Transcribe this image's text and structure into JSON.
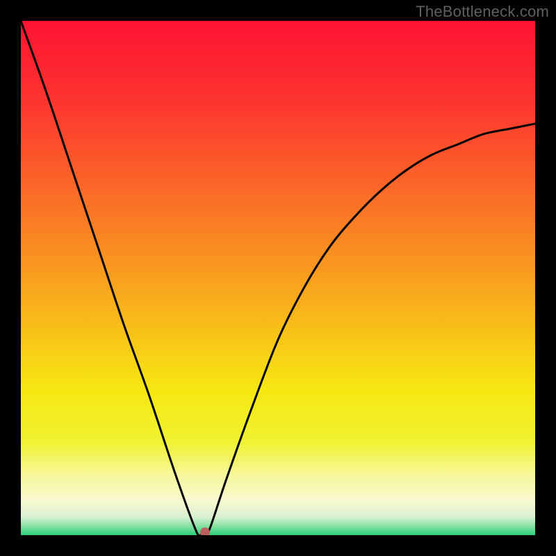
{
  "watermark": "TheBottleneck.com",
  "chart_data": {
    "type": "line",
    "title": "",
    "xlabel": "",
    "ylabel": "",
    "xlim": [
      0,
      100
    ],
    "ylim": [
      0,
      100
    ],
    "grid": false,
    "legend": false,
    "series": [
      {
        "name": "bottleneck-curve",
        "x": [
          0,
          5,
          10,
          15,
          20,
          25,
          30,
          34,
          35,
          36,
          37,
          40,
          45,
          50,
          55,
          60,
          65,
          70,
          75,
          80,
          85,
          90,
          95,
          100
        ],
        "values": [
          100,
          86,
          71,
          56,
          41,
          27,
          12,
          1,
          0,
          0,
          2,
          11,
          25,
          38,
          48,
          56,
          62,
          67,
          71,
          74,
          76,
          78,
          79,
          80
        ]
      }
    ],
    "marker": {
      "x": 35.8,
      "y": 0.5
    },
    "gradient_stops": [
      {
        "offset": 0,
        "color": "#fd1332"
      },
      {
        "offset": 0.15,
        "color": "#fd3330"
      },
      {
        "offset": 0.3,
        "color": "#fb6029"
      },
      {
        "offset": 0.45,
        "color": "#f98f21"
      },
      {
        "offset": 0.6,
        "color": "#f8c018"
      },
      {
        "offset": 0.72,
        "color": "#f6e812"
      },
      {
        "offset": 0.82,
        "color": "#f0f232"
      },
      {
        "offset": 0.88,
        "color": "#f6f796"
      },
      {
        "offset": 0.93,
        "color": "#fafad0"
      },
      {
        "offset": 0.965,
        "color": "#d8f0d0"
      },
      {
        "offset": 0.985,
        "color": "#7adf9a"
      },
      {
        "offset": 1.0,
        "color": "#28d07a"
      }
    ]
  }
}
